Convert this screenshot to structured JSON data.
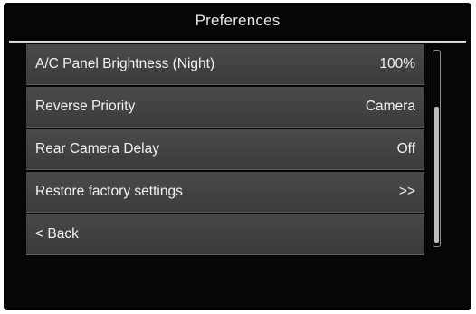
{
  "header": {
    "title": "Preferences"
  },
  "settings": [
    {
      "label": "A/C Panel Brightness (Night)",
      "value": "100%"
    },
    {
      "label": "Reverse Priority",
      "value": "Camera"
    },
    {
      "label": "Rear Camera Delay",
      "value": "Off"
    },
    {
      "label": "Restore factory settings",
      "value": ">>"
    }
  ],
  "back": {
    "label": "< Back"
  },
  "scrollbar": {
    "position_fraction": 0.4
  },
  "colors": {
    "background": "#060606",
    "row": "#444444",
    "text": "#f2f2f2"
  }
}
